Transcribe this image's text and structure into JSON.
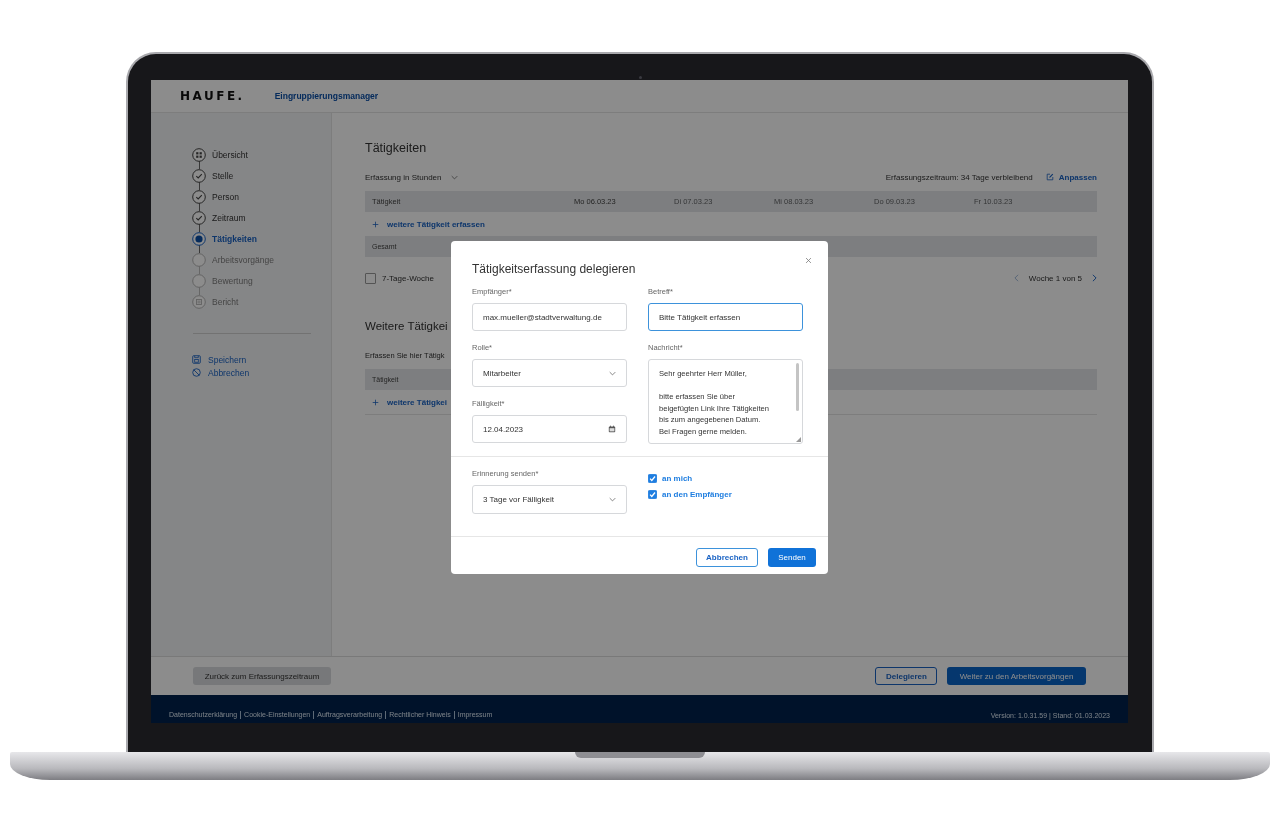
{
  "header": {
    "logo": "HAUFE.",
    "app_title": "Eingruppierungsmanager"
  },
  "sidebar": {
    "steps": [
      {
        "label": "Übersicht",
        "kind": "overview",
        "selected": false,
        "disabled": false
      },
      {
        "label": "Stelle",
        "kind": "done",
        "selected": false,
        "disabled": false
      },
      {
        "label": "Person",
        "kind": "done",
        "selected": false,
        "disabled": false
      },
      {
        "label": "Zeitraum",
        "kind": "done",
        "selected": false,
        "disabled": false
      },
      {
        "label": "Tätigkeiten",
        "kind": "current",
        "selected": true,
        "disabled": false
      },
      {
        "label": "Arbeitsvorgänge",
        "kind": "open",
        "selected": false,
        "disabled": true
      },
      {
        "label": "Bewertung",
        "kind": "open",
        "selected": false,
        "disabled": true
      },
      {
        "label": "Bericht",
        "kind": "report",
        "selected": false,
        "disabled": true
      }
    ],
    "actions": [
      {
        "label": "Speichern",
        "kind": "save"
      },
      {
        "label": "Abbrechen",
        "kind": "cancel"
      }
    ]
  },
  "activities": {
    "title": "Tätigkeiten",
    "unit_select": {
      "value": "Erfassung in Stunden"
    },
    "period": "Erfassungszeitraum: 34 Tage verbleibend",
    "adjust_link": "Anpassen",
    "columns": [
      {
        "label": "Tätigkeit",
        "disabled": false
      },
      {
        "label": "Mo 06.03.23",
        "disabled": false
      },
      {
        "label": "Di 07.03.23",
        "disabled": true
      },
      {
        "label": "Mi 08.03.23",
        "disabled": true
      },
      {
        "label": "Do 09.03.23",
        "disabled": true
      },
      {
        "label": "Fr 10.03.23",
        "disabled": true
      }
    ],
    "add_link": "weitere Tätigkeit erfassen",
    "total_label": "Gesamt",
    "seven_day_week": {
      "label": "7-Tage-Woche",
      "checked": false
    },
    "pager": {
      "label": "Woche 1 von 5",
      "prev_disabled": true,
      "next_disabled": false
    }
  },
  "more_activities": {
    "title": "Weitere Tätigkei",
    "intro": "Erfassen Sie hier Tätigk",
    "column": "Tätigkeit",
    "add_link": "weitere Tätigkei"
  },
  "dialog": {
    "title": "Tätigkeitserfassung delegieren",
    "fields_left": [
      {
        "kind": "text",
        "label": "Empfänger*",
        "value": "max.mueller@stadtverwaltung.de",
        "focused": false
      },
      {
        "kind": "select",
        "label": "Rolle*",
        "value": "Mitarbeiter",
        "focused": false
      },
      {
        "kind": "date",
        "label": "Fälligkeit*",
        "value": "12.04.2023",
        "focused": false
      }
    ],
    "fields_right": [
      {
        "kind": "text",
        "label": "Betreff*",
        "value": "Bitte Tätigkeit erfassen",
        "focused": true
      },
      {
        "kind": "textarea",
        "label": "Nachricht*",
        "value": "Sehr geehrter Herr Müller,\n\nbitte erfassen Sie über\nbeigefügten Link Ihre Tätigkeiten\nbis zum angegebenen Datum.\nBei Fragen gerne melden.",
        "focused": false
      }
    ],
    "reminder": {
      "label": "Erinnerung senden*",
      "value": "3 Tage vor Fälligkeit"
    },
    "reminder_targets": [
      {
        "label": "an mich",
        "checked": true
      },
      {
        "label": "an den Empfänger",
        "checked": true
      }
    ],
    "buttons": [
      {
        "label": "Abbrechen",
        "kind": "secondary"
      },
      {
        "label": "Senden",
        "kind": "primary"
      }
    ]
  },
  "bottom_bar": {
    "back_button": "Zurück zum Erfassungszeitraum",
    "buttons": [
      {
        "label": "Delegieren",
        "kind": "secondary"
      },
      {
        "label": "Weiter zu den Arbeitsvorgängen",
        "kind": "primary"
      }
    ]
  },
  "footer": {
    "links": [
      "Datenschutzerklärung",
      "Cookie-Einstellungen",
      "Auftragsverarbeitung",
      "Rechtlicher Hinweis",
      "Impressum"
    ],
    "version": "Version: 1.0.31.59 | Stand: 01.03.2023"
  }
}
